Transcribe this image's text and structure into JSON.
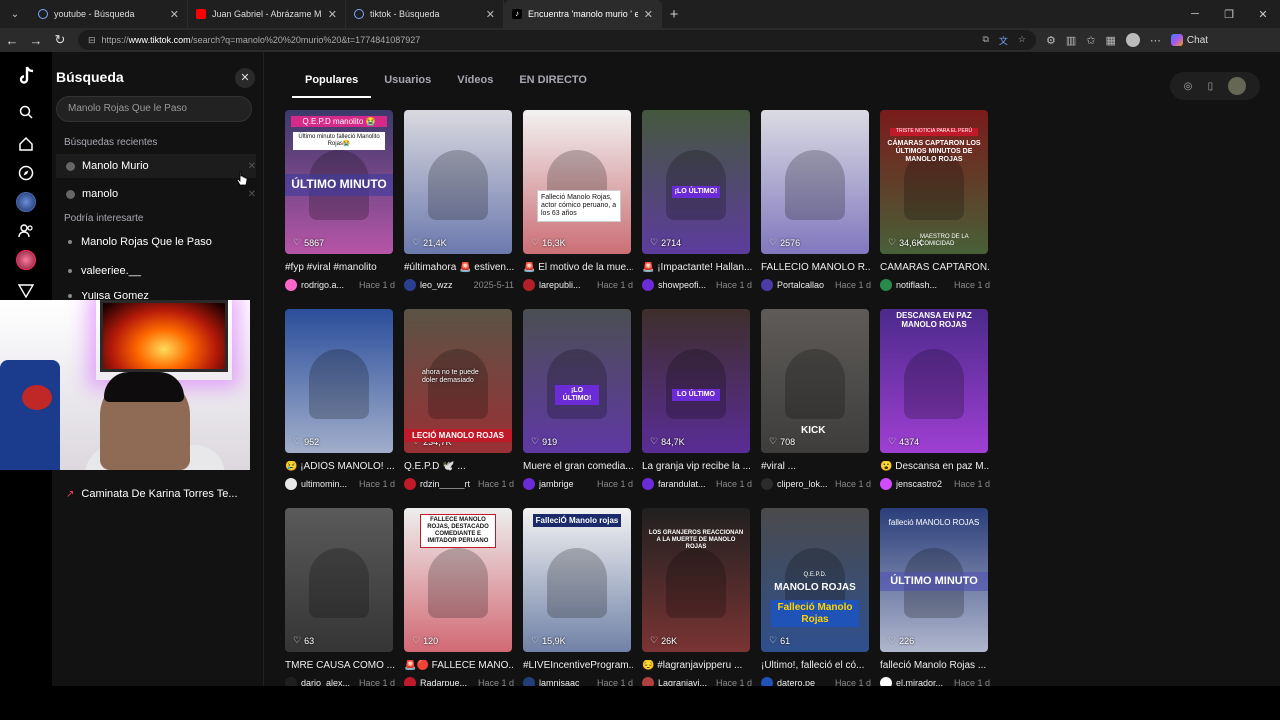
{
  "browser": {
    "tabs": [
      {
        "title": "youtube - Búsqueda",
        "icon": "search-icon",
        "color": "#7aa7ff"
      },
      {
        "title": "Juan Gabriel - Abrázame Muy Fuerte",
        "icon": "youtube-icon",
        "color": "#ff0000"
      },
      {
        "title": "tiktok - Búsqueda",
        "icon": "search-icon",
        "color": "#7aa7ff"
      },
      {
        "title": "Encuentra 'manolo murio ' en TikTok",
        "icon": "tiktok-icon",
        "color": "#ffffff"
      }
    ],
    "url_prefix": "https://",
    "url_domain": "www.tiktok.com",
    "url_rest": "/search?q=manolo%20%20murio%20&t=1774841087927",
    "chat_label": "Chat"
  },
  "panel": {
    "title": "Búsqueda",
    "search_value": "Manolo Rojas Que le Paso",
    "recent_label": "Búsquedas recientes",
    "recent": [
      "Manolo Murio",
      "manolo"
    ],
    "suggest_label": "Podría interesarte",
    "suggestions": [
      "Manolo Rojas Que le Paso",
      "valeeriee.__",
      "Yulisa Gomez"
    ],
    "trending": "Caminata De Karina Torres Te..."
  },
  "main": {
    "tabs": [
      "Populares",
      "Usuarios",
      "Vídeos",
      "EN DIRECTO"
    ]
  },
  "videos": [
    {
      "likes": "5867",
      "title": "#fyp #viral #manolito",
      "author": "rodrigo.a...",
      "time": "Hace 1 d",
      "bg": "#3b3a6a",
      "acc": "#ff66cc"
    },
    {
      "likes": "21,4K",
      "title": "#últimahora 🚨 estiven...",
      "author": "leo_wzz",
      "time": "2025-5-11",
      "bg": "#d9d9df",
      "acc": "#2a3f8f"
    },
    {
      "likes": "16,3K",
      "title": "🚨 El motivo de la mue...",
      "author": "larepubli...",
      "time": "Hace 1 d",
      "bg": "#f2f2f2",
      "acc": "#b3202a"
    },
    {
      "likes": "2714",
      "title": "🚨 ¡Impactante! Hallan...",
      "author": "showpeofi...",
      "time": "Hace 1 d",
      "bg": "#45583e",
      "acc": "#6b2bd6"
    },
    {
      "likes": "2576",
      "title": "FALLECIÓ MANOLO R...",
      "author": "Portalcallao",
      "time": "Hace 1 d",
      "bg": "#dadbe3",
      "acc": "#4b3ca8"
    },
    {
      "likes": "34,6K",
      "title": "CÁMARAS CAPTARON...",
      "author": "notiflash...",
      "time": "Hace 1 d",
      "bg": "#7a1b1b",
      "acc": "#2a8a4a"
    },
    {
      "likes": "952",
      "title": "😢 ¡ADIÓS MANOLO! ...",
      "author": "ultimomin...",
      "time": "Hace 1 d",
      "bg": "#2b4e9b",
      "acc": "#e8e8e8"
    },
    {
      "likes": "234,7K",
      "title": "Q.E.P.D 🕊️ ...",
      "author": "rdzin_____rt",
      "time": "Hace 1 d",
      "bg": "#5a5446",
      "acc": "#c01a2a"
    },
    {
      "likes": "919",
      "title": "Muere el gran comedia...",
      "author": "jambrige",
      "time": "Hace 1 d",
      "bg": "#4b4f52",
      "acc": "#6b2bd6"
    },
    {
      "likes": "84,7K",
      "title": "La granja vip recibe la ...",
      "author": "farandulat...",
      "time": "Hace 1 d",
      "bg": "#3d2f2b",
      "acc": "#6b2bd6"
    },
    {
      "likes": "708",
      "title": "#viral ...",
      "author": "clipero_lok...",
      "time": "Hace 1 d",
      "bg": "#5e5b58",
      "acc": "#2b2b2b"
    },
    {
      "likes": "4374",
      "title": "😮 Descansa en paz M...",
      "author": "jenscastro2",
      "time": "Hace 1 d",
      "bg": "#4b2a8a",
      "acc": "#d14cff"
    },
    {
      "likes": "63",
      "title": "TMRE CAUSA COMO ...",
      "author": "dario_alex...",
      "time": "Hace 1 d",
      "bg": "#5a5a5a",
      "acc": "#1f1f1f"
    },
    {
      "likes": "120",
      "title": "🚨🔴 FALLECE MANO...",
      "author": "Radarpue...",
      "time": "Hace 1 d",
      "bg": "#eeeeee",
      "acc": "#c01a2a"
    },
    {
      "likes": "15,9K",
      "title": "#LIVEIncentiveProgram...",
      "author": "lamnisaac",
      "time": "Hace 1 d",
      "bg": "#f2f2f2",
      "acc": "#233f7a"
    },
    {
      "likes": "26K",
      "title": "😔 #lagranjavipperu ...",
      "author": "Lagranjavi...",
      "time": "Hace 1 d",
      "bg": "#202020",
      "acc": "#b04040"
    },
    {
      "likes": "61",
      "title": "¡Último!, falleció el có...",
      "author": "datero.pe",
      "time": "Hace 1 d",
      "bg": "#4a4a4a",
      "acc": "#1f53b8"
    },
    {
      "likes": "226",
      "title": "falleció Manolo Rojas ...",
      "author": "el.mirador...",
      "time": "Hace 1 d",
      "bg": "#2b3e7a",
      "acc": "#ffffff"
    }
  ],
  "thumb_text": {
    "t0": "Q.E.P.D manolito 😭",
    "t0b": "Último minuto falleció Manolito Rojas😭",
    "t0c": "ÚLTIMO MINUTO",
    "t2": "Falleció Manolo Rojas, actor cómico peruano, a los 63 años",
    "t3": "¡LO ÚLTIMO!",
    "t5a": "TRISTE NOTICIA PARA EL PERÚ",
    "t5b": "CÁMARAS CAPTARON LOS ÚLTIMOS MINUTOS DE MANOLO ROJAS",
    "t5c": "MAESTRO DE LA COMICIDAD",
    "t7": "LECIÓ MANOLO ROJAS",
    "t7b": "ahora no te puede doler demasiado",
    "t8": "¡LO ÚLTIMO!",
    "t9": "LO ÚLTIMO",
    "t10": "KICK",
    "t11": "DESCANSA EN PAZ MANOLO ROJAS",
    "t13": "FALLECE MANOLO ROJAS, DESTACADO COMEDIANTE E IMITADOR PERUANO",
    "t14": "FalleciÓ Manolo rojas",
    "t15": "LOS GRANJEROS REACCIONAN A LA MUERTE DE MANOLO ROJAS",
    "t16a": "Q.E.P.D.",
    "t16b": "MANOLO ROJAS",
    "t16c": "Falleció Manolo Rojas",
    "t17a": "falleció MANOLO ROJAS",
    "t17b": "ÚLTIMO MINUTO"
  }
}
